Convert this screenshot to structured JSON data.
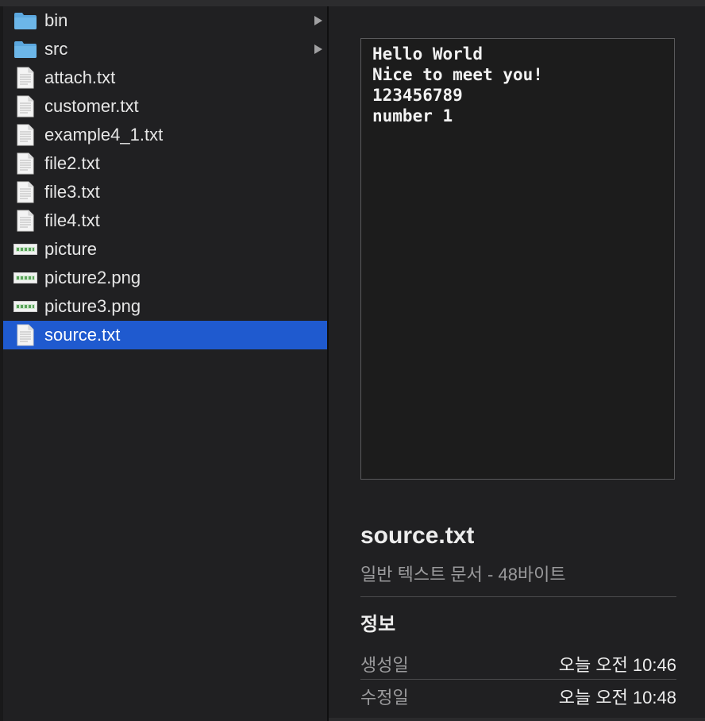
{
  "files": [
    {
      "name": "bin",
      "icon": "folder-icon",
      "type": "folder",
      "has_children": true
    },
    {
      "name": "src",
      "icon": "folder-icon",
      "type": "folder",
      "has_children": true
    },
    {
      "name": "attach.txt",
      "icon": "text-file-icon",
      "type": "text"
    },
    {
      "name": "customer.txt",
      "icon": "text-file-icon",
      "type": "text"
    },
    {
      "name": "example4_1.txt",
      "icon": "text-file-icon",
      "type": "text"
    },
    {
      "name": "file2.txt",
      "icon": "text-file-icon",
      "type": "text"
    },
    {
      "name": "file3.txt",
      "icon": "text-file-icon",
      "type": "text"
    },
    {
      "name": "file4.txt",
      "icon": "text-file-icon",
      "type": "text"
    },
    {
      "name": "picture",
      "icon": "image-file-icon",
      "type": "image"
    },
    {
      "name": "picture2.png",
      "icon": "image-file-icon",
      "type": "image"
    },
    {
      "name": "picture3.png",
      "icon": "image-file-icon",
      "type": "image"
    },
    {
      "name": "source.txt",
      "icon": "text-file-icon",
      "type": "text",
      "selected": true
    }
  ],
  "preview": {
    "lines": [
      "Hello World",
      "Nice to meet you!",
      "123456789",
      "number 1"
    ]
  },
  "info": {
    "file_name": "source.txt",
    "kind_size": "일반 텍스트 문서 - 48바이트",
    "section_title": "정보",
    "created_label": "생성일",
    "created_value": "오늘 오전 10:46",
    "modified_label": "수정일",
    "modified_value": "오늘 오전 10:48"
  },
  "colors": {
    "selection": "#1f5acf",
    "folder": "#5ba7de",
    "background": "#202022"
  }
}
